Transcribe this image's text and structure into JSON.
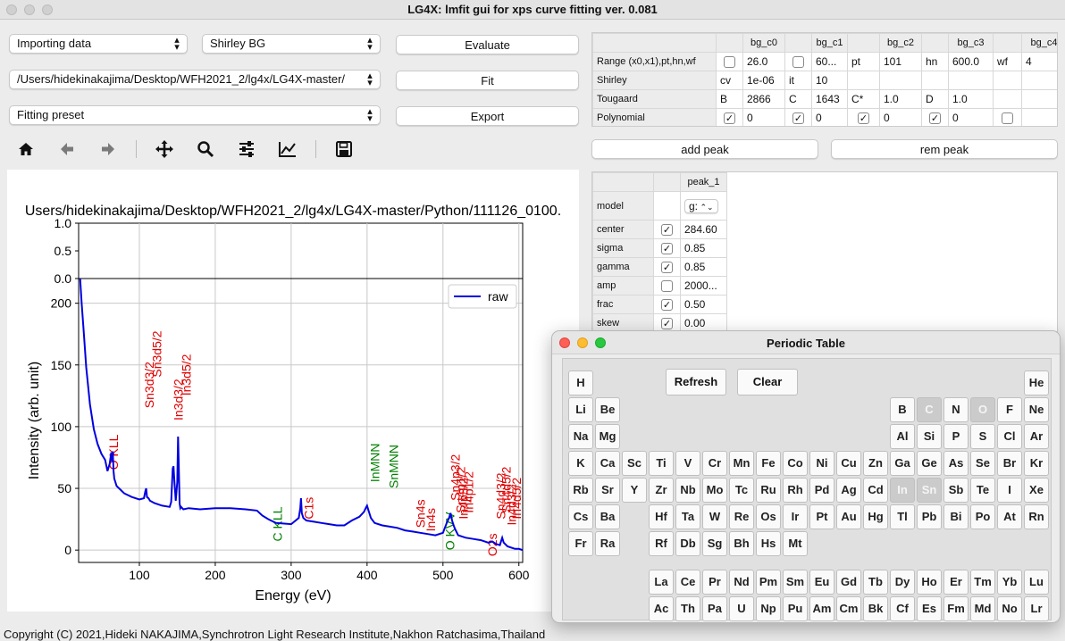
{
  "window": {
    "title": "LG4X: lmfit gui for xps curve fitting ver. 0.081"
  },
  "controls": {
    "importing": "Importing data",
    "bg_type": "Shirley BG",
    "file_path": "/Users/hidekinakajima/Desktop/WFH2021_2/lg4x/LG4X-master/",
    "preset": "Fitting preset",
    "evaluate": "Evaluate",
    "fit": "Fit",
    "export": "Export",
    "add_peak": "add peak",
    "rem_peak": "rem peak"
  },
  "toolbar": {
    "icons": [
      "home-icon",
      "back-arrow-icon",
      "forward-arrow-icon",
      "pan-icon",
      "zoom-icon",
      "configure-subplots-icon",
      "edit-axis-icon",
      "save-icon"
    ]
  },
  "bg_table": {
    "headers": [
      "bg_c0",
      "bg_c1",
      "bg_c2",
      "bg_c3",
      "bg_c4"
    ],
    "rows": [
      {
        "label": "Range (x0,x1),pt,hn,wf",
        "cells": [
          {
            "cb": false
          },
          "26.0",
          {
            "cb": false
          },
          "60...",
          "pt",
          "101",
          "hn",
          "600.0",
          "wf",
          "4"
        ]
      },
      {
        "label": "Shirley",
        "cells": [
          "cv",
          "1e-06",
          "it",
          "10",
          "",
          "",
          "",
          "",
          "",
          ""
        ]
      },
      {
        "label": "Tougaard",
        "cells": [
          "B",
          "2866",
          "C",
          "1643",
          "C*",
          "1.0",
          "D",
          "1.0",
          "",
          ""
        ]
      },
      {
        "label": "Polynomial",
        "cells": [
          {
            "cb": true
          },
          "0",
          {
            "cb": true
          },
          "0",
          {
            "cb": true
          },
          "0",
          {
            "cb": true
          },
          "0",
          {
            "cb": false
          },
          ""
        ]
      }
    ]
  },
  "peak_table": {
    "header": "peak_1",
    "model_label": "model",
    "model_value": "g:",
    "rows": [
      {
        "label": "center",
        "cb": true,
        "value": "284.60"
      },
      {
        "label": "sigma",
        "cb": true,
        "value": "0.85"
      },
      {
        "label": "gamma",
        "cb": true,
        "value": "0.85"
      },
      {
        "label": "amp",
        "cb": false,
        "value": "2000..."
      },
      {
        "label": "frac",
        "cb": true,
        "value": "0.50"
      },
      {
        "label": "skew",
        "cb": true,
        "value": "0.00"
      }
    ]
  },
  "chart_data": {
    "type": "line",
    "title": "Users/hidekinakajima/Desktop/WFH2021_2/lg4x/LG4X-master/Python/111126_0100.",
    "xlabel": "Energy (eV)",
    "ylabel": "Intensity (arb. unit)",
    "xlim": [
      20,
      605
    ],
    "ylim": [
      -10,
      220
    ],
    "xticks": [
      100,
      200,
      300,
      400,
      500,
      600
    ],
    "yticks": [
      0,
      50,
      100,
      150,
      200
    ],
    "residual_yticks": [
      "1.0",
      "0.5",
      "0.0"
    ],
    "legend": "top-right",
    "grid": true,
    "series": [
      {
        "name": "raw",
        "color": "#0000e0",
        "x": [
          22,
          24,
          27,
          30,
          35,
          40,
          45,
          50,
          55,
          58,
          61,
          63,
          64,
          65,
          66,
          67,
          70,
          75,
          80,
          90,
          100,
          106,
          108,
          109,
          110,
          112,
          114,
          120,
          130,
          140,
          142,
          143,
          144,
          145,
          146,
          148,
          150,
          151,
          152,
          153,
          154,
          155,
          158,
          165,
          180,
          200,
          220,
          240,
          255,
          262,
          270,
          280,
          300,
          310,
          312,
          313,
          314,
          316,
          320,
          330,
          340,
          350,
          360,
          370,
          380,
          390,
          396,
          399,
          400,
          402,
          405,
          410,
          420,
          430,
          440,
          450,
          460,
          470,
          480,
          490,
          500,
          505,
          508,
          510,
          512,
          514,
          516,
          520,
          530,
          540,
          550,
          560,
          565,
          570,
          575,
          577,
          578,
          580,
          585,
          590,
          595,
          600,
          605
        ],
        "y": [
          223,
          200,
          175,
          148,
          118,
          98,
          86,
          78,
          73,
          64,
          70,
          79,
          72,
          80,
          64,
          58,
          52,
          49,
          46,
          43,
          41,
          42,
          48,
          50,
          43,
          42,
          40,
          38,
          36,
          35,
          39,
          53,
          66,
          68,
          58,
          40,
          55,
          92,
          68,
          38,
          34,
          35,
          33,
          34,
          33,
          34,
          34,
          33,
          32,
          28,
          25,
          22,
          21,
          26,
          34,
          42,
          30,
          26,
          24,
          23,
          22,
          21,
          20,
          20,
          24,
          27,
          31,
          35,
          36,
          32,
          26,
          22,
          20,
          19,
          18,
          16,
          15,
          14,
          13,
          12,
          14,
          22,
          26,
          30,
          24,
          20,
          17,
          12,
          10,
          9,
          8,
          6,
          7,
          5,
          4,
          8,
          10,
          6,
          3,
          2,
          1,
          1,
          0
        ]
      }
    ],
    "annotations": [
      {
        "text": "O KLL",
        "x": 66,
        "y": 65,
        "color": "red"
      },
      {
        "text": "Sn3d3/2",
        "x": 113,
        "y": 115,
        "color": "red"
      },
      {
        "text": "Sn3d5/2",
        "x": 123,
        "y": 140,
        "color": "red"
      },
      {
        "text": "In3d3/2",
        "x": 151,
        "y": 105,
        "color": "red"
      },
      {
        "text": "In3d5/2",
        "x": 162,
        "y": 125,
        "color": "red"
      },
      {
        "text": "C KLL",
        "x": 282,
        "y": 7,
        "color": "green"
      },
      {
        "text": "C1s",
        "x": 323,
        "y": 25,
        "color": "red"
      },
      {
        "text": "InMNN",
        "x": 410,
        "y": 55,
        "color": "green"
      },
      {
        "text": "SnMNN",
        "x": 435,
        "y": 50,
        "color": "green"
      },
      {
        "text": "Sn4s",
        "x": 470,
        "y": 18,
        "color": "red"
      },
      {
        "text": "In4s",
        "x": 484,
        "y": 15,
        "color": "red"
      },
      {
        "text": "Sn4p3/2",
        "x": 516,
        "y": 40,
        "color": "red"
      },
      {
        "text": "Sn4p1/2",
        "x": 523,
        "y": 30,
        "color": "red"
      },
      {
        "text": "In4p3/2",
        "x": 527,
        "y": 25,
        "color": "red"
      },
      {
        "text": "In4p1/2",
        "x": 534,
        "y": 30,
        "color": "red"
      },
      {
        "text": "O KVV",
        "x": 509,
        "y": 0,
        "color": "green"
      },
      {
        "text": "O2s",
        "x": 565,
        "y": -5,
        "color": "red"
      },
      {
        "text": "Sn4d3/2",
        "x": 576,
        "y": 25,
        "color": "red"
      },
      {
        "text": "Sn4d5/2",
        "x": 583,
        "y": 30,
        "color": "red"
      },
      {
        "text": "In4d3/2",
        "x": 590,
        "y": 20,
        "color": "red"
      },
      {
        "text": "In4d5/2",
        "x": 597,
        "y": 25,
        "color": "red"
      }
    ]
  },
  "periodic": {
    "title": "Periodic Table",
    "refresh": "Refresh",
    "clear": "Clear",
    "selected": [
      "C",
      "O",
      "In",
      "Sn"
    ],
    "rows": [
      [
        "H",
        null,
        null,
        null,
        null,
        null,
        null,
        null,
        null,
        null,
        null,
        null,
        null,
        null,
        null,
        null,
        null,
        "He"
      ],
      [
        "Li",
        "Be",
        null,
        null,
        null,
        null,
        null,
        null,
        null,
        null,
        null,
        null,
        "B",
        "C",
        "N",
        "O",
        "F",
        "Ne"
      ],
      [
        "Na",
        "Mg",
        null,
        null,
        null,
        null,
        null,
        null,
        null,
        null,
        null,
        null,
        "Al",
        "Si",
        "P",
        "S",
        "Cl",
        "Ar"
      ],
      [
        "K",
        "Ca",
        "Sc",
        "Ti",
        "V",
        "Cr",
        "Mn",
        "Fe",
        "Co",
        "Ni",
        "Cu",
        "Zn",
        "Ga",
        "Ge",
        "As",
        "Se",
        "Br",
        "Kr"
      ],
      [
        "Rb",
        "Sr",
        "Y",
        "Zr",
        "Nb",
        "Mo",
        "Tc",
        "Ru",
        "Rh",
        "Pd",
        "Ag",
        "Cd",
        "In",
        "Sn",
        "Sb",
        "Te",
        "I",
        "Xe"
      ],
      [
        "Cs",
        "Ba",
        null,
        "Hf",
        "Ta",
        "W",
        "Re",
        "Os",
        "Ir",
        "Pt",
        "Au",
        "Hg",
        "Tl",
        "Pb",
        "Bi",
        "Po",
        "At",
        "Rn"
      ],
      [
        "Fr",
        "Ra",
        null,
        "Rf",
        "Db",
        "Sg",
        "Bh",
        "Hs",
        "Mt",
        null,
        null,
        null,
        null,
        null,
        null,
        null,
        null,
        null
      ]
    ],
    "lanthanides": [
      "La",
      "Ce",
      "Pr",
      "Nd",
      "Pm",
      "Sm",
      "Eu",
      "Gd",
      "Tb",
      "Dy",
      "Ho",
      "Er",
      "Tm",
      "Yb",
      "Lu"
    ],
    "actinides": [
      "Ac",
      "Th",
      "Pa",
      "U",
      "Np",
      "Pu",
      "Am",
      "Cm",
      "Bk",
      "Cf",
      "Es",
      "Fm",
      "Md",
      "No",
      "Lr"
    ]
  },
  "footer": "Copyright (C) 2021,Hideki NAKAJIMA,Synchrotron Light Research Institute,Nakhon Ratchasima,Thailand"
}
